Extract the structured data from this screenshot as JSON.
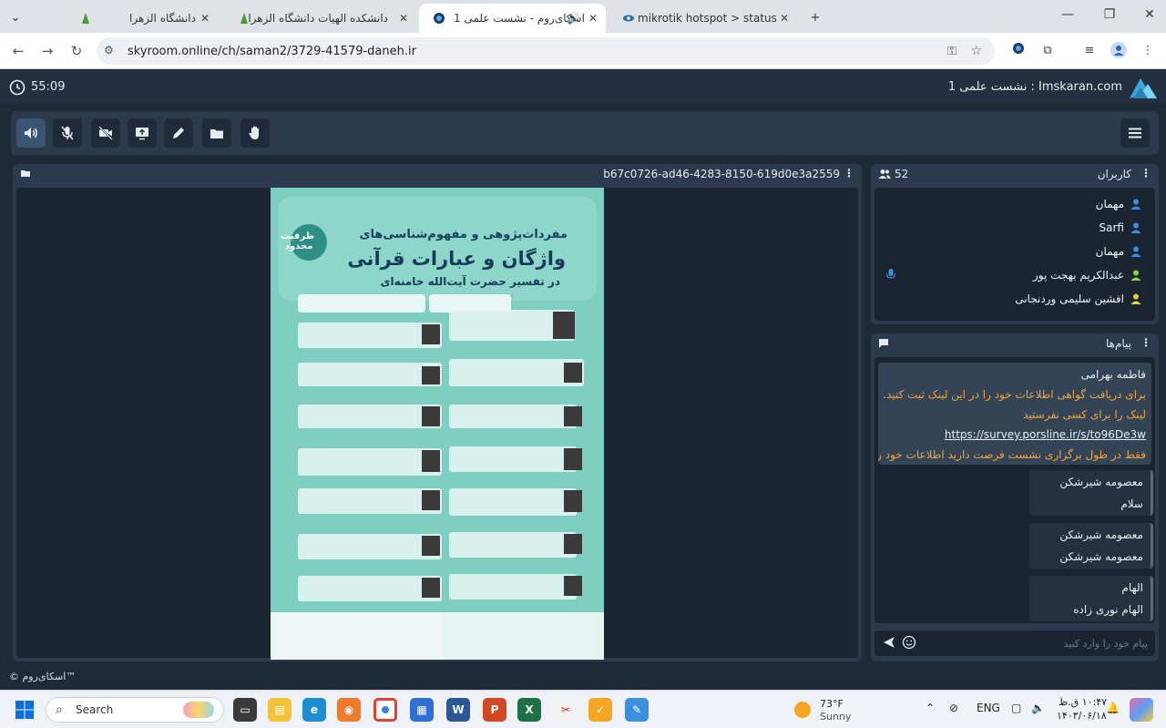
{
  "browser": {
    "tabs": [
      {
        "title": "دانشگاه الزهرا"
      },
      {
        "title": "دانشکده الهیات دانشگاه الزهرا"
      },
      {
        "title": "اسکای‌روم - نشست علمی 1"
      },
      {
        "title": "mikrotik hotspot > status"
      }
    ],
    "url": "skyroom.online/ch/saman2/3729-41579-daneh.ir"
  },
  "app": {
    "timer": "55:09",
    "room_title": "Imskaran.com : نشست علمی 1",
    "presenter_id": "b67c0726-ad46-4283-8150-619d0e3a2559",
    "footer_brand": "© اسکای‌روم™"
  },
  "users_panel": {
    "title": "کاربران",
    "count": "52",
    "users": [
      {
        "name": "مهمان",
        "icon_color": "#3b8fe8"
      },
      {
        "name": "Sarfi",
        "icon_color": "#3b8fe8"
      },
      {
        "name": "مهمان",
        "icon_color": "#3b8fe8"
      },
      {
        "name": "عبدالکریم بهجت پور",
        "icon_color": "#8bd44a"
      },
      {
        "name": "افشین سلیمی وردنجانی",
        "icon_color": "#e7d23a"
      }
    ]
  },
  "messages_panel": {
    "title": "پیام‌ها",
    "input_placeholder": "پیام خود را وارد کنید",
    "messages": [
      {
        "name": "فاطمه بهرامی",
        "line1": "برای دریافت گواهی اطلاعات خود را در این لینک ثبت کنید.",
        "line2": "لینک را برای کسی نفرستید",
        "link": "https://survey.porsline.ir/s/to96De3w",
        "line3": "فقط در طول برگزاری نشست فرصت دارید اطلاعات خود را"
      },
      {
        "name": "معصومه شیرشکن",
        "text": "سلام"
      },
      {
        "name": "معصومه شیرشکن",
        "text": "معصومه شیرشکن"
      },
      {
        "name": "الهام",
        "text": "الهام نوری زاده"
      }
    ]
  },
  "poster": {
    "title_line1": "مفردات‌پژوهی و مفهوم‌شناسی‌های",
    "title_line2": "واژگان و عبارات قرآنی",
    "title_line3": "در تفسیر حضرت آیت‌الله خامنه‌ای",
    "badge": "ظرفیت محدود"
  },
  "taskbar": {
    "search_label": "Search",
    "weather_temp": "73°F",
    "weather_cond": "Sunny",
    "lang": "ENG",
    "time": "۱۰:۴۷ ق.ظ",
    "date": "۱۴۰۳/۰۶/۱۸"
  }
}
